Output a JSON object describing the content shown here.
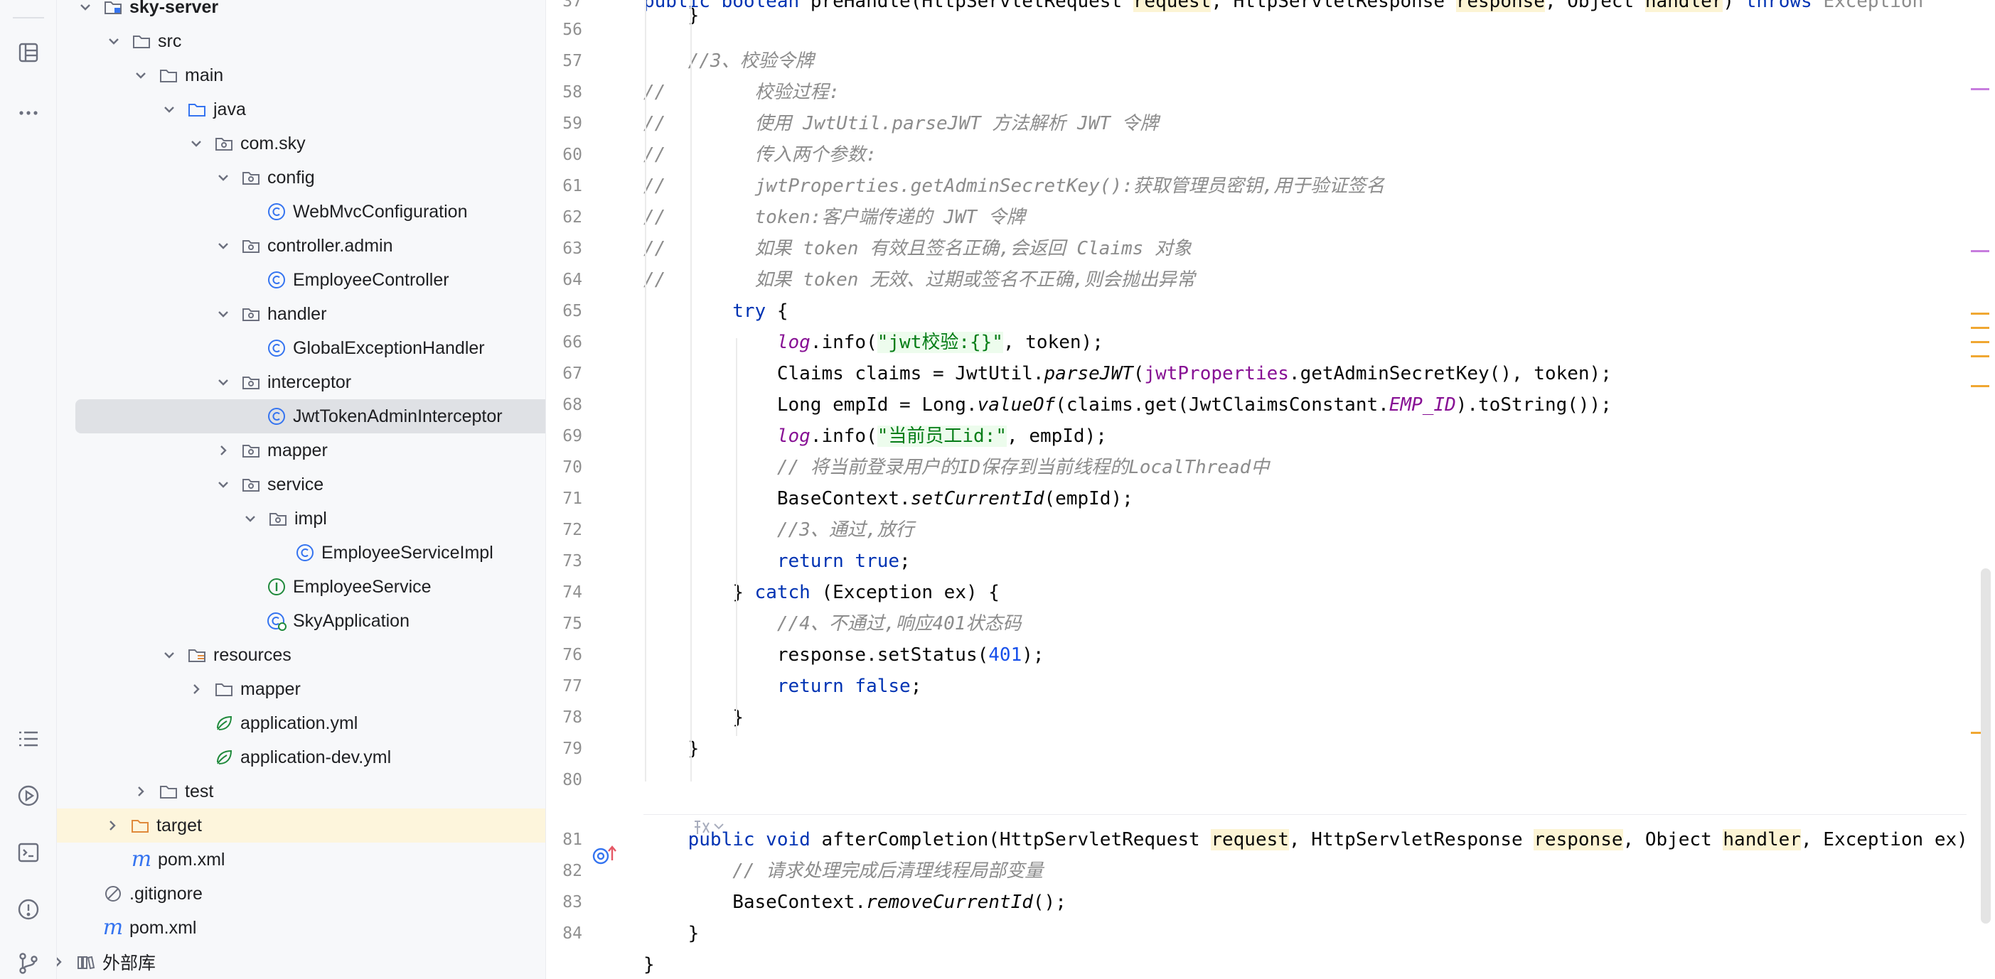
{
  "activity_bar": {
    "icons": [
      "structure-icon",
      "more-icon",
      "todo-list-icon",
      "run-icon",
      "terminal-icon",
      "problems-icon",
      "git-icon"
    ]
  },
  "project_tree": {
    "items": [
      {
        "label": "sky-server",
        "bold": true,
        "chevron": "down",
        "icon": "module-folder-icon"
      },
      {
        "label": "src",
        "chevron": "down",
        "icon": "folder-icon"
      },
      {
        "label": "main",
        "chevron": "down",
        "icon": "folder-icon"
      },
      {
        "label": "java",
        "chevron": "down",
        "icon": "source-folder-icon"
      },
      {
        "label": "com.sky",
        "chevron": "down",
        "icon": "package-icon"
      },
      {
        "label": "config",
        "chevron": "down",
        "icon": "package-icon"
      },
      {
        "label": "WebMvcConfiguration",
        "chevron": "none",
        "icon": "class-icon"
      },
      {
        "label": "controller.admin",
        "chevron": "down",
        "icon": "package-icon"
      },
      {
        "label": "EmployeeController",
        "chevron": "none",
        "icon": "class-icon"
      },
      {
        "label": "handler",
        "chevron": "down",
        "icon": "package-icon"
      },
      {
        "label": "GlobalExceptionHandler",
        "chevron": "none",
        "icon": "class-icon"
      },
      {
        "label": "interceptor",
        "chevron": "down",
        "icon": "package-icon"
      },
      {
        "label": "JwtTokenAdminInterceptor",
        "chevron": "none",
        "icon": "class-icon",
        "selected": true
      },
      {
        "label": "mapper",
        "chevron": "right",
        "icon": "package-icon"
      },
      {
        "label": "service",
        "chevron": "down",
        "icon": "package-icon"
      },
      {
        "label": "impl",
        "chevron": "down",
        "icon": "package-icon"
      },
      {
        "label": "EmployeeServiceImpl",
        "chevron": "none",
        "icon": "class-icon"
      },
      {
        "label": "EmployeeService",
        "chevron": "none",
        "icon": "interface-icon"
      },
      {
        "label": "SkyApplication",
        "chevron": "none",
        "icon": "spring-boot-app-icon"
      },
      {
        "label": "resources",
        "chevron": "down",
        "icon": "resources-folder-icon"
      },
      {
        "label": "mapper",
        "chevron": "right",
        "icon": "folder-icon"
      },
      {
        "label": "application.yml",
        "chevron": "none",
        "icon": "spring-yml-icon"
      },
      {
        "label": "application-dev.yml",
        "chevron": "none",
        "icon": "spring-yml-icon"
      },
      {
        "label": "test",
        "chevron": "right",
        "icon": "folder-icon"
      },
      {
        "label": "target",
        "chevron": "right",
        "icon": "excluded-folder-icon",
        "highlighted": true
      },
      {
        "label": "pom.xml",
        "chevron": "none",
        "icon": "maven-icon"
      },
      {
        "label": ".gitignore",
        "chevron": "none",
        "icon": "ignore-file-icon"
      },
      {
        "label": "pom.xml",
        "chevron": "none",
        "icon": "maven-icon"
      },
      {
        "label": "外部库",
        "chevron": "right",
        "icon": "library-icon"
      }
    ]
  },
  "editor": {
    "lines": [
      {
        "n": "37",
        "tokens": [
          [
            "kw",
            "public boolean "
          ],
          [
            "",
            "preHandle(HttpServletRequest "
          ],
          [
            "prm",
            "request"
          ],
          [
            "",
            ", HttpServletResponse "
          ],
          [
            "prm",
            "response"
          ],
          [
            "",
            ", Object "
          ],
          [
            "prm",
            "handler"
          ],
          [
            "",
            ") "
          ],
          [
            "kw",
            "throws "
          ],
          [
            "gry",
            "Exception"
          ]
        ]
      },
      {
        "n": "",
        "tokens": [
          [
            "",
            "    }"
          ]
        ]
      },
      {
        "n": "56",
        "tokens": []
      },
      {
        "n": "57",
        "tokens": [
          [
            "cm",
            "    //3、校验令牌"
          ]
        ]
      },
      {
        "n": "58",
        "tokens": [
          [
            "cm",
            "//        校验过程:"
          ]
        ]
      },
      {
        "n": "59",
        "tokens": [
          [
            "cm",
            "//        使用 JwtUtil.parseJWT 方法解析 JWT 令牌"
          ]
        ]
      },
      {
        "n": "60",
        "tokens": [
          [
            "cm",
            "//        传入两个参数:"
          ]
        ]
      },
      {
        "n": "61",
        "tokens": [
          [
            "cm",
            "//        jwtProperties.getAdminSecretKey():获取管理员密钥,用于验证签名"
          ]
        ]
      },
      {
        "n": "62",
        "tokens": [
          [
            "cm",
            "//        token:客户端传递的 JWT 令牌"
          ]
        ]
      },
      {
        "n": "63",
        "tokens": [
          [
            "cm",
            "//        如果 token 有效且签名正确,会返回 Claims 对象"
          ]
        ]
      },
      {
        "n": "64",
        "tokens": [
          [
            "cm",
            "//        如果 token 无效、过期或签名不正确,则会抛出异常"
          ]
        ]
      },
      {
        "n": "65",
        "tokens": [
          [
            "kw",
            "        try"
          ],
          [
            "",
            " {"
          ]
        ]
      },
      {
        "n": "66",
        "tokens": [
          [
            "",
            "            "
          ],
          [
            "fldi",
            "log"
          ],
          [
            "",
            ".info("
          ],
          [
            "st",
            "\"jwt校验:{}\""
          ],
          [
            "",
            ", token);"
          ]
        ]
      },
      {
        "n": "67",
        "tokens": [
          [
            "",
            "            Claims claims = JwtUtil."
          ],
          [
            "sm",
            "parseJWT"
          ],
          [
            "",
            "("
          ],
          [
            "fld",
            "jwtProperties"
          ],
          [
            "",
            ".getAdminSecretKey(), token);"
          ]
        ]
      },
      {
        "n": "68",
        "tokens": [
          [
            "",
            "            Long empId = Long."
          ],
          [
            "sm",
            "valueOf"
          ],
          [
            "",
            "(claims.get(JwtClaimsConstant."
          ],
          [
            "fldi",
            "EMP_ID"
          ],
          [
            "",
            ").toString());"
          ]
        ]
      },
      {
        "n": "69",
        "tokens": [
          [
            "",
            "            "
          ],
          [
            "fldi",
            "log"
          ],
          [
            "",
            ".info("
          ],
          [
            "st",
            "\"当前员工id:\""
          ],
          [
            "",
            ", empId);"
          ]
        ]
      },
      {
        "n": "70",
        "tokens": [
          [
            "cm",
            "            // 将当前登录用户的ID保存到当前线程的LocalThread中"
          ]
        ]
      },
      {
        "n": "71",
        "tokens": [
          [
            "",
            "            BaseContext."
          ],
          [
            "sm",
            "setCurrentId"
          ],
          [
            "",
            "(empId);"
          ]
        ]
      },
      {
        "n": "72",
        "tokens": [
          [
            "cm",
            "            //3、通过,放行"
          ]
        ]
      },
      {
        "n": "73",
        "tokens": [
          [
            "kw",
            "            return true"
          ],
          [
            "",
            ";"
          ]
        ]
      },
      {
        "n": "74",
        "tokens": [
          [
            "",
            "        } "
          ],
          [
            "kw",
            "catch"
          ],
          [
            "",
            " (Exception ex) {"
          ]
        ]
      },
      {
        "n": "75",
        "tokens": [
          [
            "cm",
            "            //4、不通过,响应401状态码"
          ]
        ]
      },
      {
        "n": "76",
        "tokens": [
          [
            "",
            "            response.setStatus("
          ],
          [
            "num",
            "401"
          ],
          [
            "",
            ");"
          ]
        ]
      },
      {
        "n": "77",
        "tokens": [
          [
            "kw",
            "            return false"
          ],
          [
            "",
            ";"
          ]
        ]
      },
      {
        "n": "78",
        "tokens": [
          [
            "",
            "        }"
          ]
        ]
      },
      {
        "n": "79",
        "tokens": [
          [
            "",
            "    }"
          ]
        ]
      },
      {
        "n": "80",
        "tokens": []
      },
      {
        "n": "",
        "tokens": []
      },
      {
        "n": "81",
        "tokens": [
          [
            "kw",
            "    public void "
          ],
          [
            "",
            "afterCompletion(HttpServletRequest "
          ],
          [
            "prm",
            "request"
          ],
          [
            "",
            ", HttpServletResponse "
          ],
          [
            "prm",
            "response"
          ],
          [
            "",
            ", Object "
          ],
          [
            "prm",
            "handler"
          ],
          [
            "",
            ", Exception ex) "
          ]
        ]
      },
      {
        "n": "82",
        "tokens": [
          [
            "cm",
            "        // 请求处理完成后清理线程局部变量"
          ]
        ]
      },
      {
        "n": "83",
        "tokens": [
          [
            "",
            "        BaseContext."
          ],
          [
            "sm",
            "removeCurrentId"
          ],
          [
            "",
            "();"
          ]
        ]
      },
      {
        "n": "84",
        "tokens": [
          [
            "",
            "    }"
          ]
        ]
      },
      {
        "n": "",
        "tokens": [
          [
            "",
            "}"
          ]
        ]
      }
    ]
  }
}
